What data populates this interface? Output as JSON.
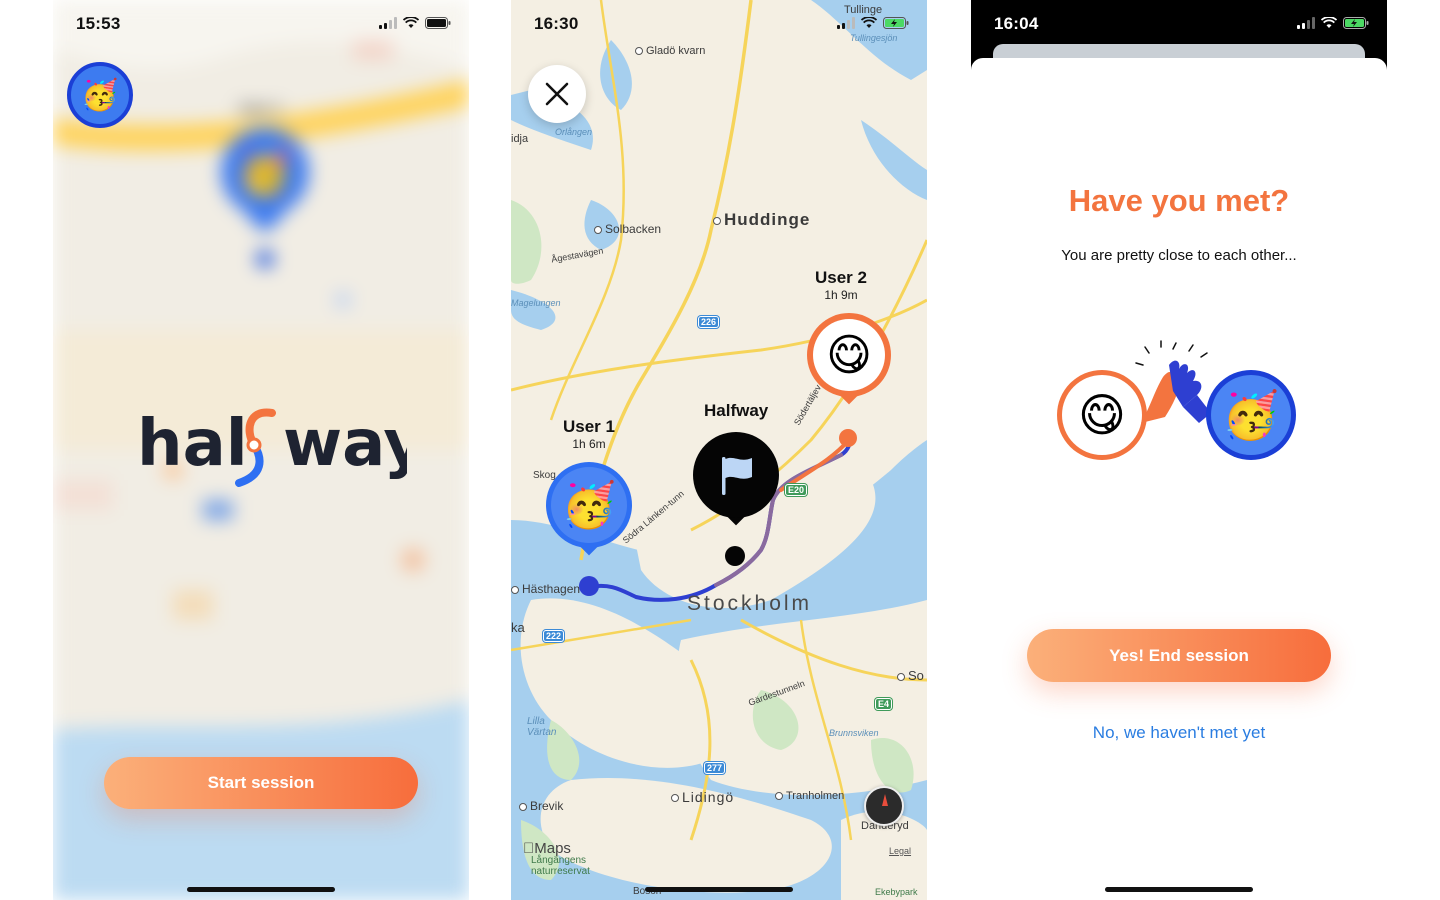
{
  "screens": [
    {
      "status_time": "15:53",
      "map_user_label": "User 1",
      "logo_text": "halfway",
      "start_button": "Start session",
      "user_avatar_icon": "party-face-emoji",
      "emoji": "🥳"
    },
    {
      "status_time": "16:30",
      "close_icon": "close-icon",
      "user1": {
        "name": "User 1",
        "eta": "1h 6m",
        "emoji": "🥳",
        "color": "#2e6ff2"
      },
      "user2": {
        "name": "User 2",
        "eta": "1h 9m",
        "emoji": "😋",
        "color": "#f3743f"
      },
      "halfway_label": "Halfway",
      "map_labels": {
        "tullinge": "Tullinge",
        "tullingesjon": "Tullingesjön",
        "glado_kvarn": "Gladö kvarn",
        "orlangen": "Orlången",
        "idja": "idja",
        "huddinge": "Huddinge",
        "solbacken": "Solbacken",
        "agestavagen": "Ågestavägen",
        "magelungen": "Magelungen",
        "road_226": "226",
        "sodertaljev": "Södertäljev",
        "skog": "Skog",
        "sodra_lanken": "Södra Länken-tunn",
        "e20": "E20",
        "hasthagen": "Hästhagen",
        "stockholm": "Stockholm",
        "ka": "ka",
        "road_222": "222",
        "so": "So",
        "gardestunneln": "Gärdestunneln",
        "e4": "E4",
        "brunnsviken": "Brunnsviken",
        "lilla_vartan": "Lilla\nVärtan",
        "road_277": "277",
        "brevik": "Brevik",
        "lidingo": "Lidingö",
        "tranholmen": "Tranholmen",
        "danderyd": "Danderyd",
        "legal": "Legal",
        "maps": "Maps",
        "langangens": "Långängens\nnaturreservat",
        "boson": "Bosön",
        "ekebypark": "Ekebypark"
      }
    },
    {
      "status_time": "16:04",
      "title": "Have you met?",
      "subtitle": "You are pretty close to each other...",
      "end_button": "Yes! End session",
      "not_met_link": "No, we haven't met yet",
      "user2_emoji": "😋",
      "user1_emoji": "🥳",
      "high_five_icon": "high-five-hands-icon"
    }
  ],
  "colors": {
    "accent_orange": "#f3743f",
    "accent_blue": "#2e6ff2",
    "link_blue": "#2a7de1"
  }
}
